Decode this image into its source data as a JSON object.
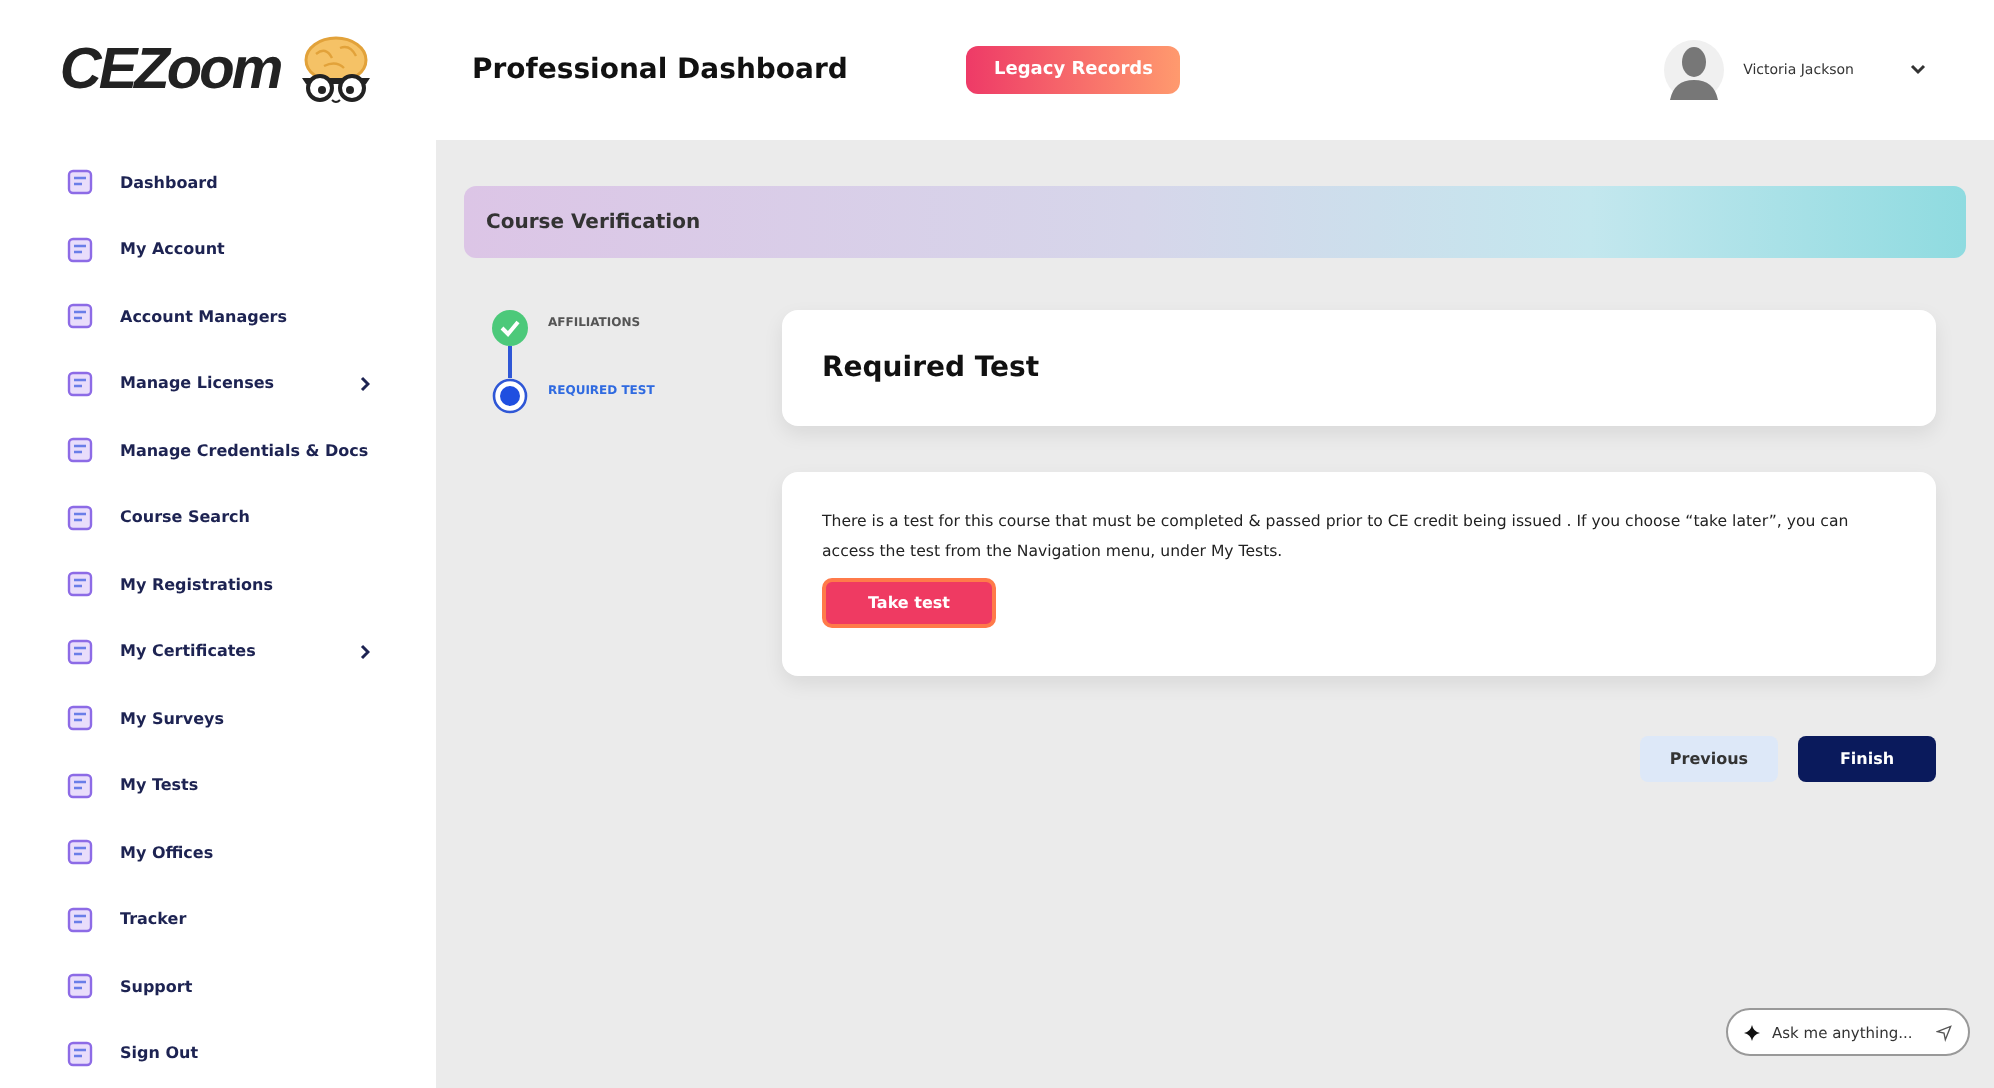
{
  "header": {
    "logo_text": "CEZoom",
    "title": "Professional Dashboard",
    "legacy_button": "Legacy Records",
    "user_name": "Victoria Jackson"
  },
  "sidebar": {
    "items": [
      {
        "label": "Dashboard",
        "has_submenu": false
      },
      {
        "label": "My Account",
        "has_submenu": false
      },
      {
        "label": "Account Managers",
        "has_submenu": false
      },
      {
        "label": "Manage Licenses",
        "has_submenu": true
      },
      {
        "label": "Manage Credentials & Docs",
        "has_submenu": false
      },
      {
        "label": "Course Search",
        "has_submenu": false
      },
      {
        "label": "My Registrations",
        "has_submenu": false
      },
      {
        "label": "My Certificates",
        "has_submenu": true
      },
      {
        "label": "My Surveys",
        "has_submenu": false
      },
      {
        "label": "My Tests",
        "has_submenu": false
      },
      {
        "label": "My Offices",
        "has_submenu": false
      },
      {
        "label": "Tracker",
        "has_submenu": false
      },
      {
        "label": "Support",
        "has_submenu": false
      },
      {
        "label": "Sign Out",
        "has_submenu": false
      }
    ]
  },
  "banner": {
    "title": "Course Verification"
  },
  "steps": [
    {
      "label": "AFFILIATIONS",
      "kind": "done"
    },
    {
      "label": "REQUIRED TEST",
      "kind": "current"
    }
  ],
  "card": {
    "title": "Required Test",
    "message": "There is a test for this course that must be completed & passed prior to CE credit being issued . If you choose “take later”, you can access the test from the Navigation menu, under My Tests.",
    "button": "Take test"
  },
  "footer_buttons": {
    "previous": "Previous",
    "finish": "Finish"
  },
  "chat": {
    "placeholder": "Ask me anything..."
  }
}
